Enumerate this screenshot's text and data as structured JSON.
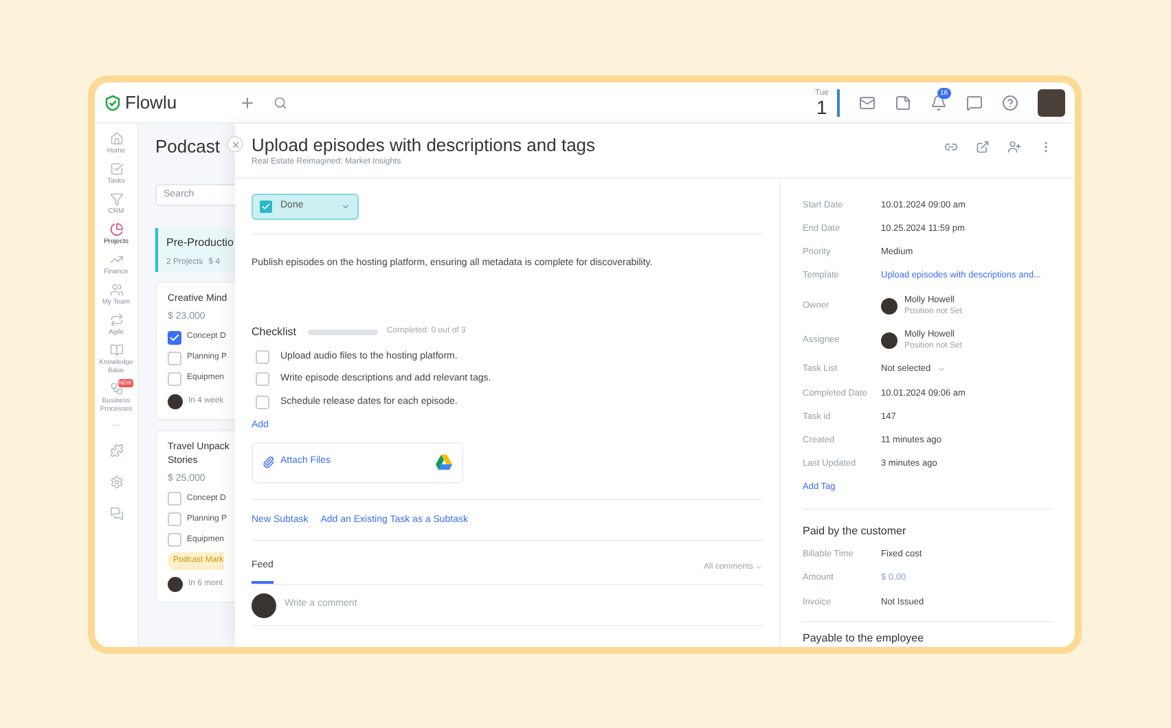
{
  "topbar": {
    "logo": "Flowlu",
    "day": "Tue",
    "date": "1",
    "notification_count": "16"
  },
  "nav": [
    {
      "label": "Home",
      "selected": false
    },
    {
      "label": "Tasks",
      "selected": false
    },
    {
      "label": "CRM",
      "selected": false
    },
    {
      "label": "Projects",
      "selected": true
    },
    {
      "label": "Finance",
      "selected": false
    },
    {
      "label": "My Team",
      "selected": false
    },
    {
      "label": "Agile",
      "selected": false
    },
    {
      "label": "Knowledge Base",
      "selected": false
    },
    {
      "label": "Business Processes",
      "selected": false,
      "badge": "NEW"
    }
  ],
  "nav_more": "...",
  "board": {
    "title": "Podcast",
    "search_placeholder": "Search",
    "stage": {
      "name": "Pre-Productio",
      "projects": "2 Projects",
      "amount": "$ 4"
    },
    "cards": [
      {
        "title": "Creative Mind",
        "amount": "$ 23,000",
        "items": [
          {
            "label": "Concept D",
            "checked": true
          },
          {
            "label": "Planning P",
            "checked": false
          },
          {
            "label": "Equipmen",
            "checked": false
          }
        ],
        "due": "In 4 week"
      },
      {
        "title": "Travel Unpack Stories",
        "amount": "$ 25,000",
        "items": [
          {
            "label": "Concept D",
            "checked": false
          },
          {
            "label": "Planning P",
            "checked": false
          },
          {
            "label": "Equipmen",
            "checked": false
          }
        ],
        "tag": "Podcast Mark",
        "due": "In 6 mont"
      }
    ]
  },
  "task": {
    "title": "Upload episodes with descriptions and tags",
    "project": "Real Estate Reimagined: Market Insights",
    "status": "Done",
    "status_done": true,
    "description": "Publish episodes on the hosting platform, ensuring all metadata is complete for discoverability.",
    "checklist": {
      "title": "Checklist",
      "progress": "Completed: 0 out of 3",
      "items": [
        {
          "label": "Upload audio files to the hosting platform.",
          "checked": false
        },
        {
          "label": "Write episode descriptions and add relevant tags.",
          "checked": false
        },
        {
          "label": "Schedule release dates for each episode.",
          "checked": false
        }
      ],
      "add": "Add"
    },
    "attach": "Attach Files",
    "subtask_links": [
      "New Subtask",
      "Add an Existing Task as a Subtask"
    ],
    "feed": {
      "tab": "Feed",
      "filter": "All comments",
      "comment_placeholder": "Write a comment"
    }
  },
  "details": [
    {
      "kind": "text",
      "label": "Start Date",
      "value": "10.01.2024 09:00 am"
    },
    {
      "kind": "text",
      "label": "End Date",
      "value": "10.25.2024 11:59 pm"
    },
    {
      "kind": "text",
      "label": "Priority",
      "value": "Medium"
    },
    {
      "kind": "link",
      "label": "Template",
      "value": "Upload episodes with descriptions and..."
    },
    {
      "kind": "person",
      "label": "Owner",
      "value": "Molly Howell",
      "sub": "Position not Set"
    },
    {
      "kind": "person",
      "label": "Assignee",
      "value": "Molly Howell",
      "sub": "Position not Set"
    },
    {
      "kind": "select",
      "label": "Task List",
      "value": "Not selected"
    },
    {
      "kind": "text",
      "label": "Completed Date",
      "value": "10.01.2024 09:06 am"
    },
    {
      "kind": "text",
      "label": "Task id",
      "value": "147"
    },
    {
      "kind": "text",
      "label": "Created",
      "value": "11 minutes ago"
    },
    {
      "kind": "text",
      "label": "Last Updated",
      "value": "3 minutes ago"
    }
  ],
  "add_tag": "Add Tag",
  "billing": {
    "title": "Paid by the customer",
    "rows": [
      {
        "kind": "text",
        "label": "Billable Time",
        "value": "Fixed cost"
      },
      {
        "kind": "muted",
        "label": "Amount",
        "value": "$ 0.00"
      },
      {
        "kind": "text",
        "label": "Invoice",
        "value": "Not Issued"
      }
    ]
  },
  "next_section": "Payable to the employee"
}
